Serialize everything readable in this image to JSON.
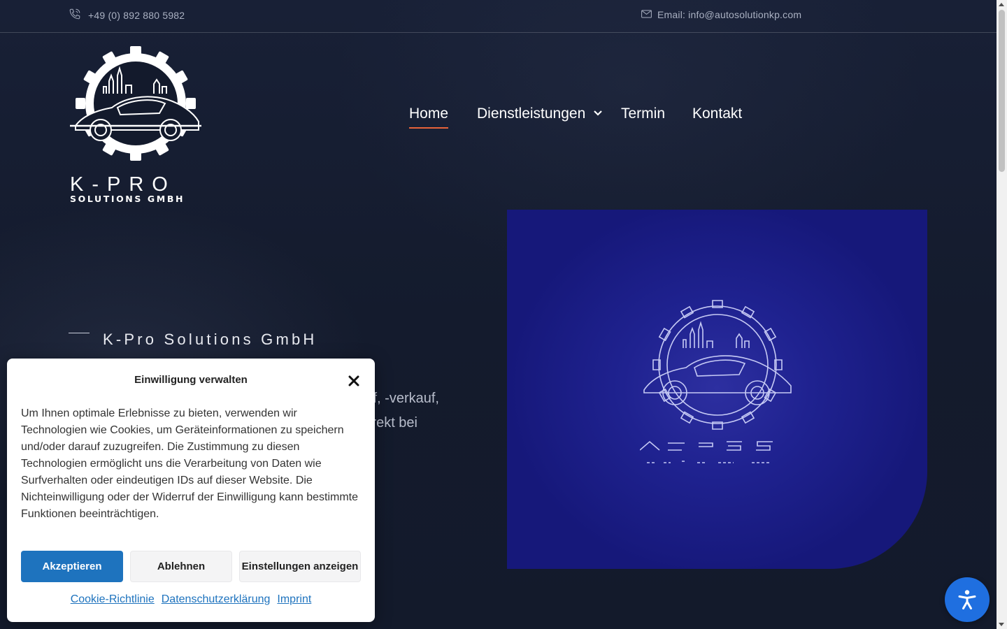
{
  "topbar": {
    "phone": "+49 (0) 892 880 5982",
    "email": "Email: info@autosolutionkp.com",
    "phone_icon": "phone-icon",
    "email_icon": "envelope-icon"
  },
  "logo": {
    "line1": "K-PRO",
    "line2": "SOLUTIONS GMBH"
  },
  "nav": {
    "items": [
      {
        "label": "Home",
        "active": true
      },
      {
        "label": "Dienstleistungen",
        "has_dropdown": true
      },
      {
        "label": "Termin"
      },
      {
        "label": "Kontakt"
      }
    ]
  },
  "hero": {
    "title": "K-Pro Solutions GmbH",
    "partial_line1": "f, -verkauf,",
    "partial_line2": "rekt bei"
  },
  "cookie": {
    "title": "Einwilligung verwalten",
    "text": "Um Ihnen optimale Erlebnisse zu bieten, verwenden wir Technologien wie Cookies, um Geräteinformationen zu speichern und/oder darauf zuzugreifen. Die Zustimmung zu diesen Technologien ermöglicht uns die Verarbeitung von Daten wie Surfverhalten oder eindeutigen IDs auf dieser Website. Die Nichteinwilligung oder der Widerruf der Einwilligung kann bestimmte Funktionen beeinträchtigen.",
    "accept": "Akzeptieren",
    "deny": "Ablehnen",
    "settings": "Einstellungen anzeigen",
    "links": [
      "Cookie-Richtlinie",
      "Datenschutzerklärung",
      "Imprint"
    ]
  },
  "colors": {
    "accent": "#e8633a",
    "primary_button": "#1e73be",
    "a11y_button": "#1f6fe0",
    "promo_bg": "#1f2290"
  }
}
